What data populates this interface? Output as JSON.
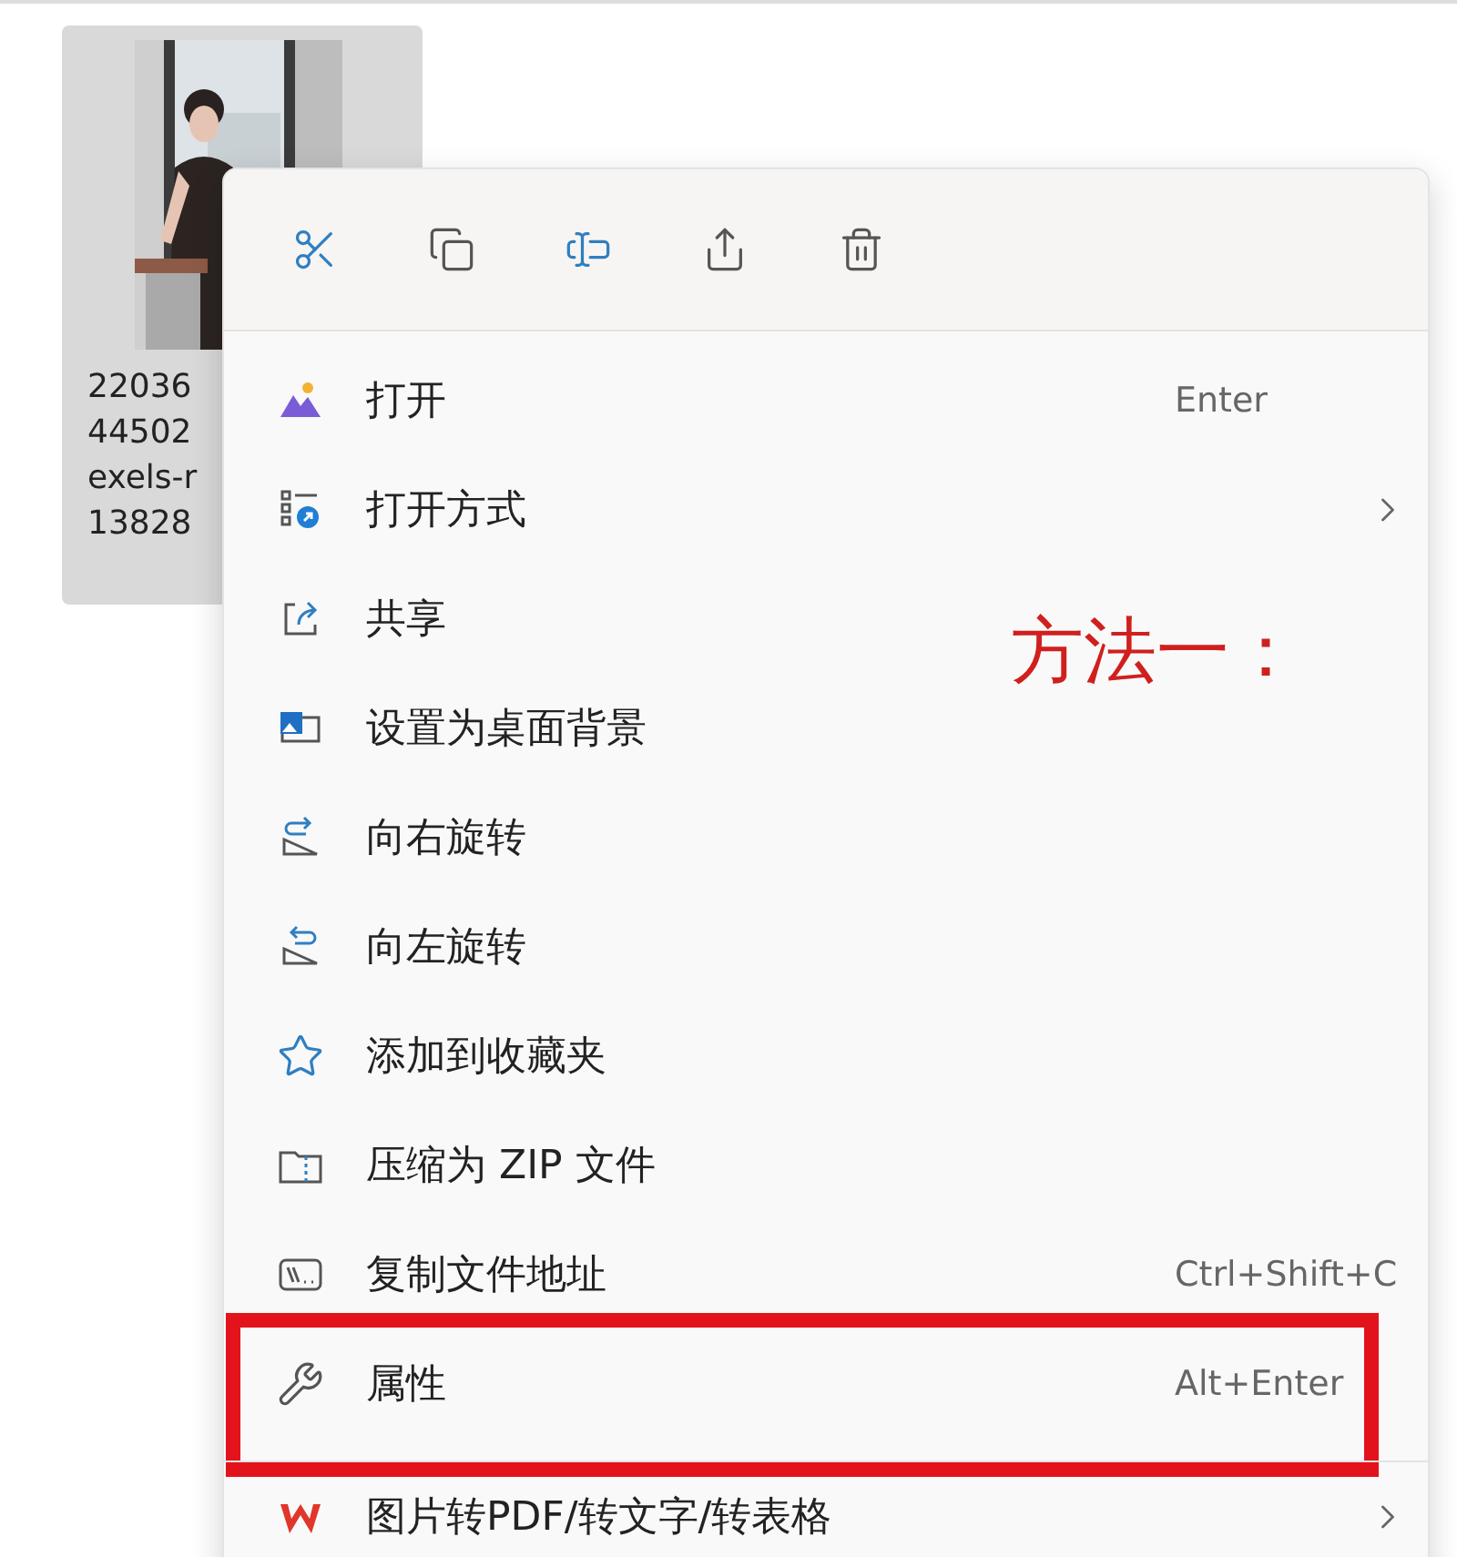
{
  "file_tile": {
    "selected": true,
    "name_lines": [
      "22036",
      "44502",
      "exels-r",
      "13828"
    ]
  },
  "context_menu": {
    "items": [
      {
        "label": "打开",
        "shortcut": "Enter",
        "has_submenu": false,
        "highlighted": false
      },
      {
        "label": "打开方式",
        "has_submenu": true,
        "highlighted": false
      },
      {
        "label": "共享",
        "has_submenu": false,
        "highlighted": false
      },
      {
        "label": "设置为桌面背景",
        "has_submenu": false,
        "highlighted": false
      },
      {
        "label": "向右旋转",
        "has_submenu": false,
        "highlighted": false
      },
      {
        "label": "向左旋转",
        "has_submenu": false,
        "highlighted": false
      },
      {
        "label": "添加到收藏夹",
        "has_submenu": false,
        "highlighted": false
      },
      {
        "label": "压缩为 ZIP 文件",
        "has_submenu": false,
        "highlighted": false
      },
      {
        "label": "复制文件地址",
        "shortcut": "Ctrl+Shift+C",
        "has_submenu": false,
        "highlighted": false
      },
      {
        "label": "属性",
        "shortcut": "Alt+Enter",
        "has_submenu": false,
        "highlighted": true
      },
      {
        "label": "图片转PDF/转文字/转表格",
        "has_submenu": true,
        "highlighted": false,
        "separated": true
      }
    ]
  },
  "annotation": {
    "text": "方法一："
  }
}
